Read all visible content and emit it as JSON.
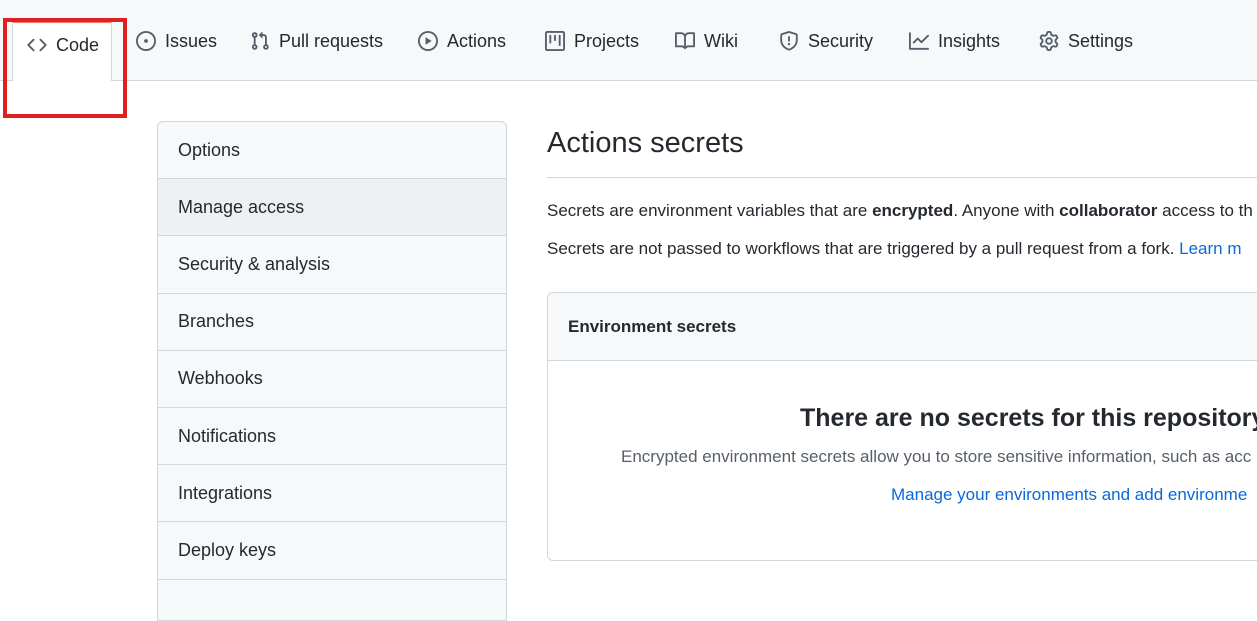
{
  "repo_nav": {
    "tabs": [
      {
        "label": "Code",
        "icon": "code-icon"
      },
      {
        "label": "Issues",
        "icon": "issue-opened-icon"
      },
      {
        "label": "Pull requests",
        "icon": "git-pull-request-icon"
      },
      {
        "label": "Actions",
        "icon": "play-icon"
      },
      {
        "label": "Projects",
        "icon": "project-icon"
      },
      {
        "label": "Wiki",
        "icon": "book-icon"
      },
      {
        "label": "Security",
        "icon": "shield-icon"
      },
      {
        "label": "Insights",
        "icon": "graph-icon"
      },
      {
        "label": "Settings",
        "icon": "gear-icon"
      }
    ],
    "active_tab": "Code",
    "highlight_color": "#e02020",
    "active_underline_color": "#f9826c"
  },
  "settings_menu": {
    "items": [
      {
        "label": "Options"
      },
      {
        "label": "Manage access"
      },
      {
        "label": "Security & analysis"
      },
      {
        "label": "Branches"
      },
      {
        "label": "Webhooks"
      },
      {
        "label": "Notifications"
      },
      {
        "label": "Integrations"
      },
      {
        "label": "Deploy keys"
      }
    ]
  },
  "main": {
    "title": "Actions secrets",
    "desc1_pre": "Secrets are environment variables that are ",
    "desc1_bold1": "encrypted",
    "desc1_mid": ". Anyone with ",
    "desc1_bold2": "collaborator",
    "desc1_post": " access to th",
    "desc2_pre": "Secrets are not passed to workflows that are triggered by a pull request from a fork. ",
    "desc2_link": "Learn m",
    "panel": {
      "header": "Environment secrets",
      "blank_title": "There are no secrets for this repository's",
      "blank_desc": "Encrypted environment secrets allow you to store sensitive information, such as acc",
      "blank_link": "Manage your environments and add environme"
    }
  },
  "colors": {
    "link": "#0969da",
    "border": "#d0d7de",
    "muted": "#57606a",
    "text": "#24292f"
  }
}
